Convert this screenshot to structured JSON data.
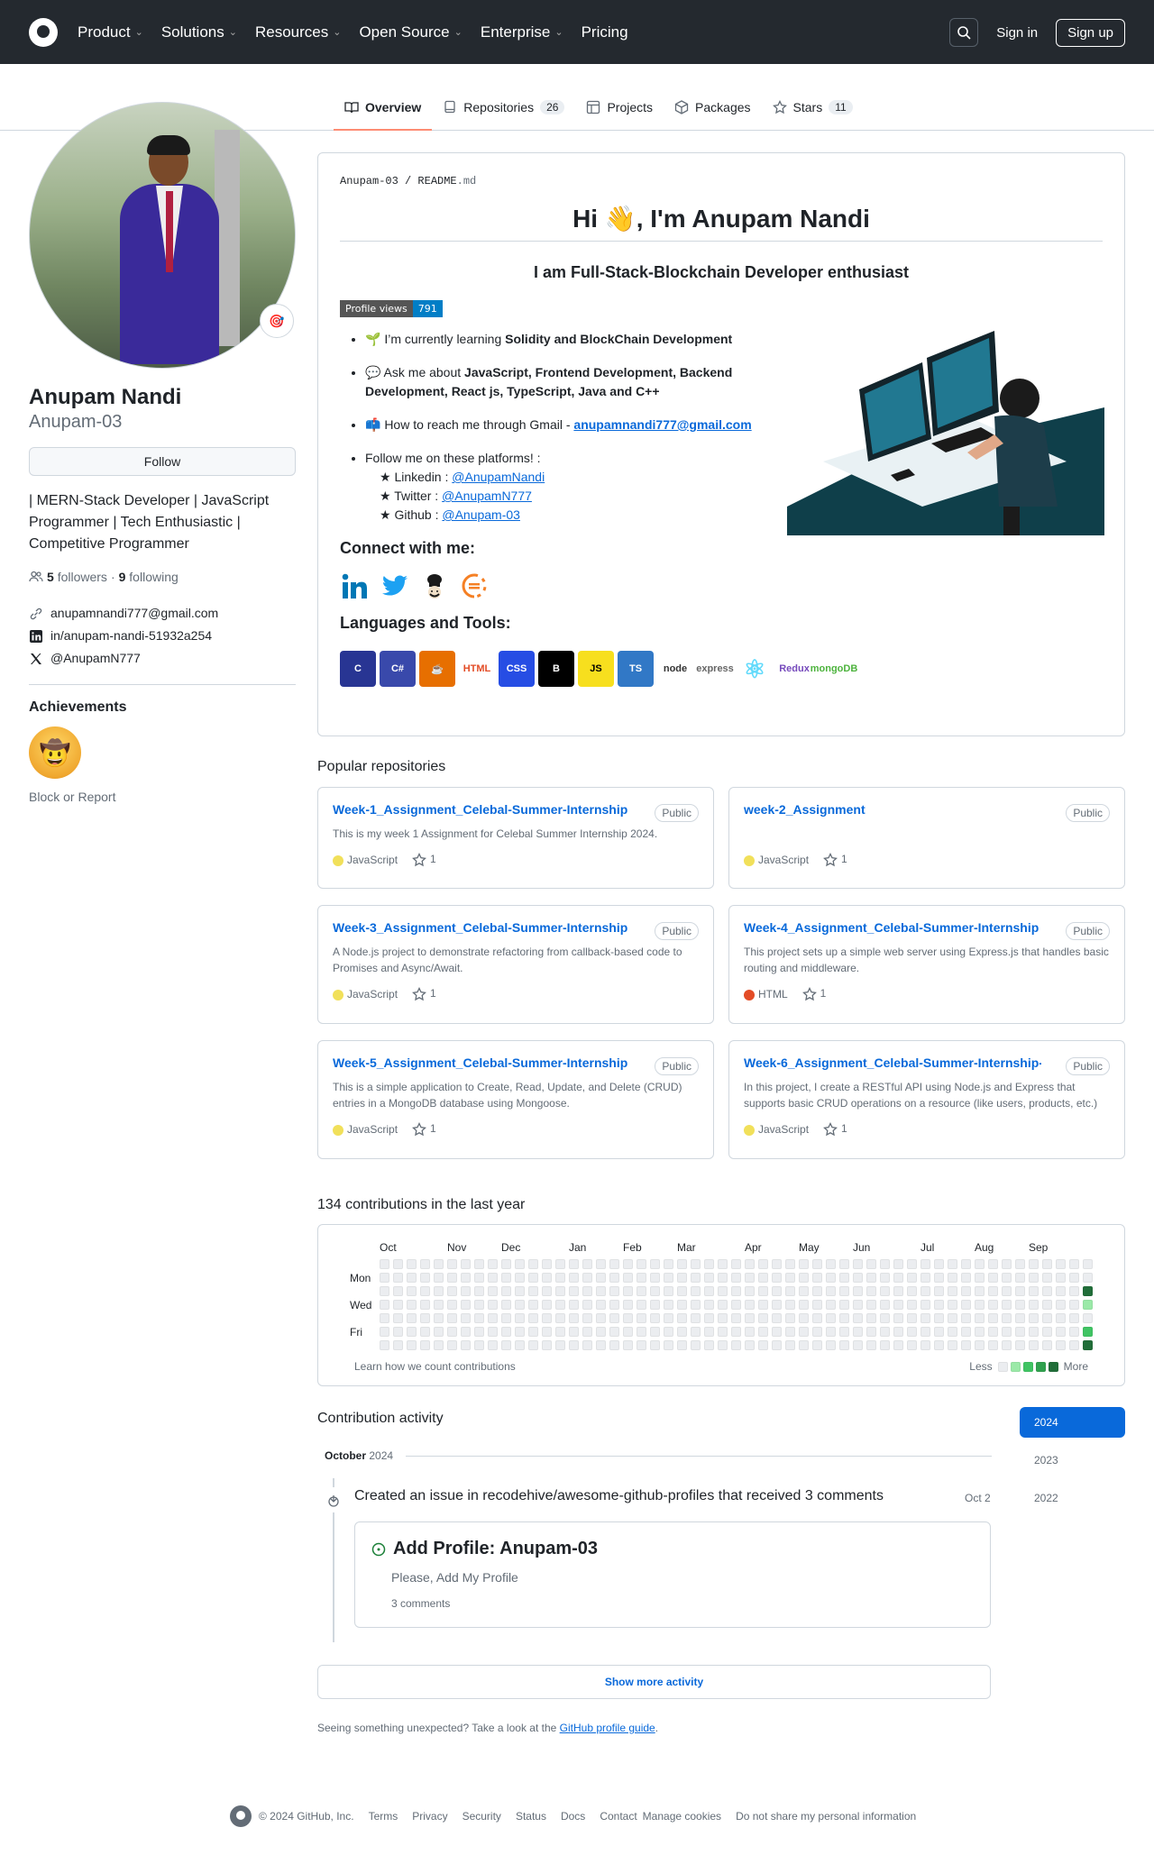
{
  "nav": {
    "items": [
      "Product",
      "Solutions",
      "Resources",
      "Open Source",
      "Enterprise",
      "Pricing"
    ],
    "signin": "Sign in",
    "signup": "Sign up"
  },
  "tabs": [
    {
      "label": "Overview",
      "count": null
    },
    {
      "label": "Repositories",
      "count": "26"
    },
    {
      "label": "Projects",
      "count": null
    },
    {
      "label": "Packages",
      "count": null
    },
    {
      "label": "Stars",
      "count": "11"
    }
  ],
  "profile": {
    "status_emoji": "🎯",
    "fullname": "Anupam Nandi",
    "login": "Anupam-03",
    "follow": "Follow",
    "bio": "| MERN-Stack Developer | JavaScript Programmer | Tech Enthusiastic | Competitive Programmer",
    "followers": "5",
    "followers_label": "followers",
    "following": "9",
    "following_label": "following",
    "links": [
      "anupamnandi777@gmail.com",
      "in/anupam-nandi-51932a254",
      "@AnupamN777"
    ],
    "achievements_title": "Achievements",
    "achievement_emoji": "🤠",
    "block": "Block or Report"
  },
  "readme": {
    "crumb_user": "Anupam-03",
    "crumb_sep": "/",
    "crumb_file": "README",
    "crumb_ext": ".md",
    "title": "Hi 👋, I'm Anupam Nandi",
    "subtitle": "I am Full-Stack-Blockchain Developer enthusiast",
    "views_label": "Profile views",
    "views_count": "791",
    "learning_prefix": "🌱 I’m currently learning ",
    "learning_bold": "Solidity and BlockChain Development",
    "ask_prefix": "💬 Ask me about ",
    "ask_bold": "JavaScript, Frontend Development, Backend Development, React js, TypeScript, Java and C++",
    "reach_prefix": "📫 How to reach me through Gmail - ",
    "reach_email": "anupamnandi777@gmail.com",
    "follow_text": "Follow me on these platforms! :",
    "platforms": [
      {
        "prefix": "★ Linkedin : ",
        "handle": "@AnupamNandi"
      },
      {
        "prefix": "★ Twitter : ",
        "handle": "@AnupamN777"
      },
      {
        "prefix": "★ Github : ",
        "handle": "@Anupam-03"
      }
    ],
    "connect": "Connect with me:",
    "languages": "Languages and Tools:",
    "tools": [
      {
        "text": "C",
        "color": "#283593"
      },
      {
        "text": "C#",
        "color": "#3949ab"
      },
      {
        "text": "☕",
        "color": "#e76f00"
      },
      {
        "text": "HTML",
        "color": "#e34c26"
      },
      {
        "text": "CSS",
        "color": "#264de4"
      },
      {
        "text": "B",
        "color": "#000000"
      },
      {
        "text": "JS",
        "color": "#f7df1e"
      },
      {
        "text": "TS",
        "color": "#3178c6"
      },
      {
        "text": "node",
        "color": "#333333"
      },
      {
        "text": "express",
        "color": "#666666"
      },
      {
        "text": "⚛",
        "color": "#61dafb"
      },
      {
        "text": "Redux",
        "color": "#764abc"
      },
      {
        "text": "mongoDB",
        "color": "#4db33d"
      }
    ]
  },
  "popular_title": "Popular repositories",
  "public_label": "Public",
  "repos": [
    {
      "name": "Week-1_Assignment_Celebal-Summer-Internship",
      "desc": "This is my week 1 Assignment for Celebal Summer Internship 2024.",
      "lang": "JavaScript",
      "color": "#f1e05a",
      "stars": "1"
    },
    {
      "name": "week-2_Assignment",
      "desc": "",
      "lang": "JavaScript",
      "color": "#f1e05a",
      "stars": "1"
    },
    {
      "name": "Week-3_Assignment_Celebal-Summer-Internship",
      "desc": "A Node.js project to demonstrate refactoring from callback-based code to Promises and Async/Await.",
      "lang": "JavaScript",
      "color": "#f1e05a",
      "stars": "1"
    },
    {
      "name": "Week-4_Assignment_Celebal-Summer-Internship",
      "desc": "This project sets up a simple web server using Express.js that handles basic routing and middleware.",
      "lang": "HTML",
      "color": "#e34c26",
      "stars": "1"
    },
    {
      "name": "Week-5_Assignment_Celebal-Summer-Internship",
      "desc": "This is a simple application to Create, Read, Update, and Delete (CRUD) entries in a MongoDB database using Mongoose.",
      "lang": "JavaScript",
      "color": "#f1e05a",
      "stars": "1"
    },
    {
      "name": "Week-6_Assignment_Celebal-Summer-Internship-",
      "desc": "In this project, I create a RESTful API using Node.js and Express that supports basic CRUD operations on a resource (like users, products, etc.)",
      "lang": "JavaScript",
      "color": "#f1e05a",
      "stars": "1"
    }
  ],
  "contrib": {
    "title": "134 contributions in the last year",
    "months": [
      "Oct",
      "Nov",
      "Dec",
      "Jan",
      "Feb",
      "Mar",
      "Apr",
      "May",
      "Jun",
      "Jul",
      "Aug",
      "Sep"
    ],
    "days": [
      "Mon",
      "Wed",
      "Fri"
    ],
    "learn": "Learn how we count contributions",
    "less": "Less",
    "more": "More"
  },
  "activity": {
    "title": "Contribution activity",
    "month": "October",
    "year": "2024",
    "years": [
      "2024",
      "2023",
      "2022"
    ],
    "event": "Created an issue in recodehive/awesome-github-profiles that received 3 comments",
    "date": "Oct 2",
    "issue_title": "Add Profile: Anupam-03",
    "issue_body": "Please, Add My Profile",
    "issue_comments": "3 comments",
    "show_more": "Show more activity",
    "unexpected_prefix": "Seeing something unexpected? Take a look at the ",
    "unexpected_link": "GitHub profile guide",
    "unexpected_suffix": "."
  },
  "footer": [
    "© 2024 GitHub, Inc.",
    "Terms",
    "Privacy",
    "Security",
    "Status",
    "Docs",
    "Contact",
    "Manage cookies",
    "Do not share my personal information"
  ]
}
